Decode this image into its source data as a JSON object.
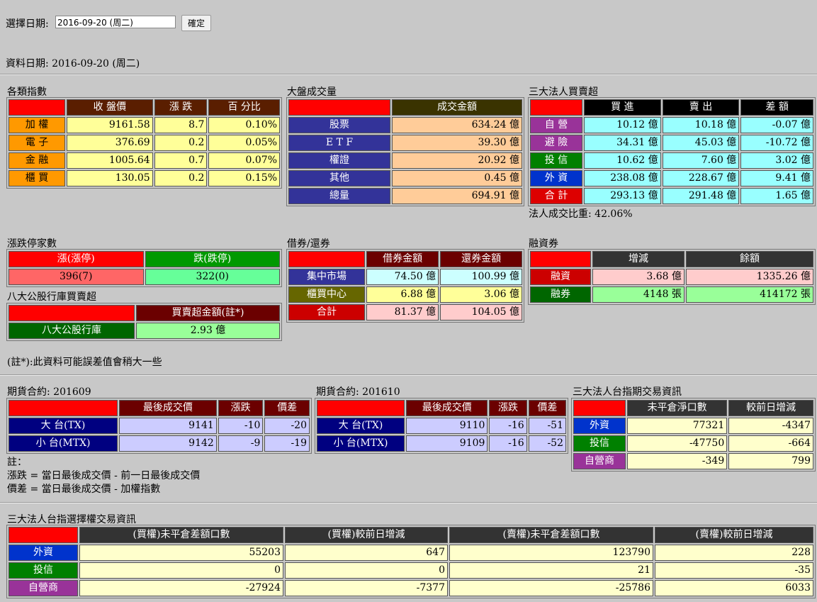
{
  "header": {
    "select_label": "選擇日期:",
    "date_value": "2016-09-20 (周二)",
    "confirm": "確定",
    "data_date": "資料日期: 2016-09-20 (周二)"
  },
  "index": {
    "title": "各類指數",
    "cols": [
      "收 盤價",
      "漲 跌",
      "百 分比"
    ],
    "rows": [
      {
        "name": "加 權",
        "close": "9161.58",
        "chg": "8.7",
        "pct": "0.10%"
      },
      {
        "name": "電 子",
        "close": "376.69",
        "chg": "0.2",
        "pct": "0.05%"
      },
      {
        "name": "金 融",
        "close": "1005.64",
        "chg": "0.7",
        "pct": "0.07%"
      },
      {
        "name": "櫃 買",
        "close": "130.05",
        "chg": "0.2",
        "pct": "0.15%"
      }
    ]
  },
  "volume": {
    "title": "大盤成交量",
    "col": "成交金額",
    "rows": [
      {
        "name": "股票",
        "val": "634.24 億"
      },
      {
        "name": "E T F",
        "val": "39.30 億"
      },
      {
        "name": "權證",
        "val": "20.92 億"
      },
      {
        "name": "其他",
        "val": "0.45 億"
      },
      {
        "name": "總量",
        "val": "694.91 億"
      }
    ]
  },
  "inst": {
    "title": "三大法人買賣超",
    "cols": [
      "買 進",
      "賣 出",
      "差 額"
    ],
    "rows": [
      {
        "name": "自 營",
        "buy": "10.12 億",
        "sell": "10.18 億",
        "diff": "-0.07 億"
      },
      {
        "name": "避 險",
        "buy": "34.31 億",
        "sell": "45.03 億",
        "diff": "-10.72 億"
      },
      {
        "name": "投 信",
        "buy": "10.62 億",
        "sell": "7.60 億",
        "diff": "3.02 億"
      },
      {
        "name": "外 資",
        "buy": "238.08 億",
        "sell": "228.67 億",
        "diff": "9.41 億"
      },
      {
        "name": "合 計",
        "buy": "293.13 億",
        "sell": "291.48 億",
        "diff": "1.65 億"
      }
    ],
    "ratio": "法人成交比重: 42.06%"
  },
  "limit": {
    "title": "漲跌停家數",
    "up_label": "漲(漲停)",
    "down_label": "跌(跌停)",
    "up_val": "396(7)",
    "down_val": "322(0)"
  },
  "eight": {
    "title": "八大公股行庫買賣超",
    "col": "買賣超金額(註*)",
    "name": "八大公股行庫",
    "val": "2.93 億"
  },
  "lend": {
    "title": "借券/還券",
    "cols": [
      "借券金額",
      "還券金額"
    ],
    "rows": [
      {
        "name": "集中市場",
        "borrow": "74.50 億",
        "ret": "100.99 億"
      },
      {
        "name": "櫃買中心",
        "borrow": "6.88 億",
        "ret": "3.06 億"
      },
      {
        "name": "合計",
        "borrow": "81.37 億",
        "ret": "104.05 億"
      }
    ]
  },
  "margin": {
    "title": "融資券",
    "cols": [
      "增減",
      "餘額"
    ],
    "rows": [
      {
        "name": "融資",
        "chg": "3.68 億",
        "bal": "1335.26 億"
      },
      {
        "name": "融券",
        "chg": "4148 張",
        "bal": "414172 張"
      }
    ]
  },
  "note1": "(註*):此資料可能誤差值會稍大一些",
  "fut1": {
    "title": "期貨合約: 201609",
    "cols": [
      "最後成交價",
      "漲跌",
      "價差"
    ],
    "rows": [
      {
        "name": "大 台(TX)",
        "price": "9141",
        "chg": "-10",
        "spread": "-20"
      },
      {
        "name": "小 台(MTX)",
        "price": "9142",
        "chg": "-9",
        "spread": "-19"
      }
    ]
  },
  "fut2": {
    "title": "期貨合約: 201610",
    "cols": [
      "最後成交價",
      "漲跌",
      "價差"
    ],
    "rows": [
      {
        "name": "大 台(TX)",
        "price": "9110",
        "chg": "-16",
        "spread": "-51"
      },
      {
        "name": "小 台(MTX)",
        "price": "9109",
        "chg": "-16",
        "spread": "-52"
      }
    ]
  },
  "futinst": {
    "title": "三大法人台指期交易資訊",
    "cols": [
      "未平倉淨口數",
      "較前日增減"
    ],
    "rows": [
      {
        "name": "外資",
        "oi": "77321",
        "chg": "-4347"
      },
      {
        "name": "投信",
        "oi": "-47750",
        "chg": "-664"
      },
      {
        "name": "自營商",
        "oi": "-349",
        "chg": "799"
      }
    ]
  },
  "notes": {
    "l1": "註：",
    "l2": "漲跌 = 當日最後成交價 - 前一日最後成交價",
    "l3": "價差 = 當日最後成交價 - 加權指數"
  },
  "opt": {
    "title": "三大法人台指選擇權交易資訊",
    "cols": [
      "(買權)未平倉差額口數",
      "(買權)較前日增減",
      "(賣權)未平倉差額口數",
      "(賣權)較前日增減"
    ],
    "rows": [
      {
        "name": "外資",
        "c1": "55203",
        "c2": "647",
        "c3": "123790",
        "c4": "228"
      },
      {
        "name": "投信",
        "c1": "0",
        "c2": "0",
        "c3": "21",
        "c4": "-35"
      },
      {
        "name": "自營商",
        "c1": "-27924",
        "c2": "-7377",
        "c3": "-25786",
        "c4": "6033"
      }
    ]
  }
}
